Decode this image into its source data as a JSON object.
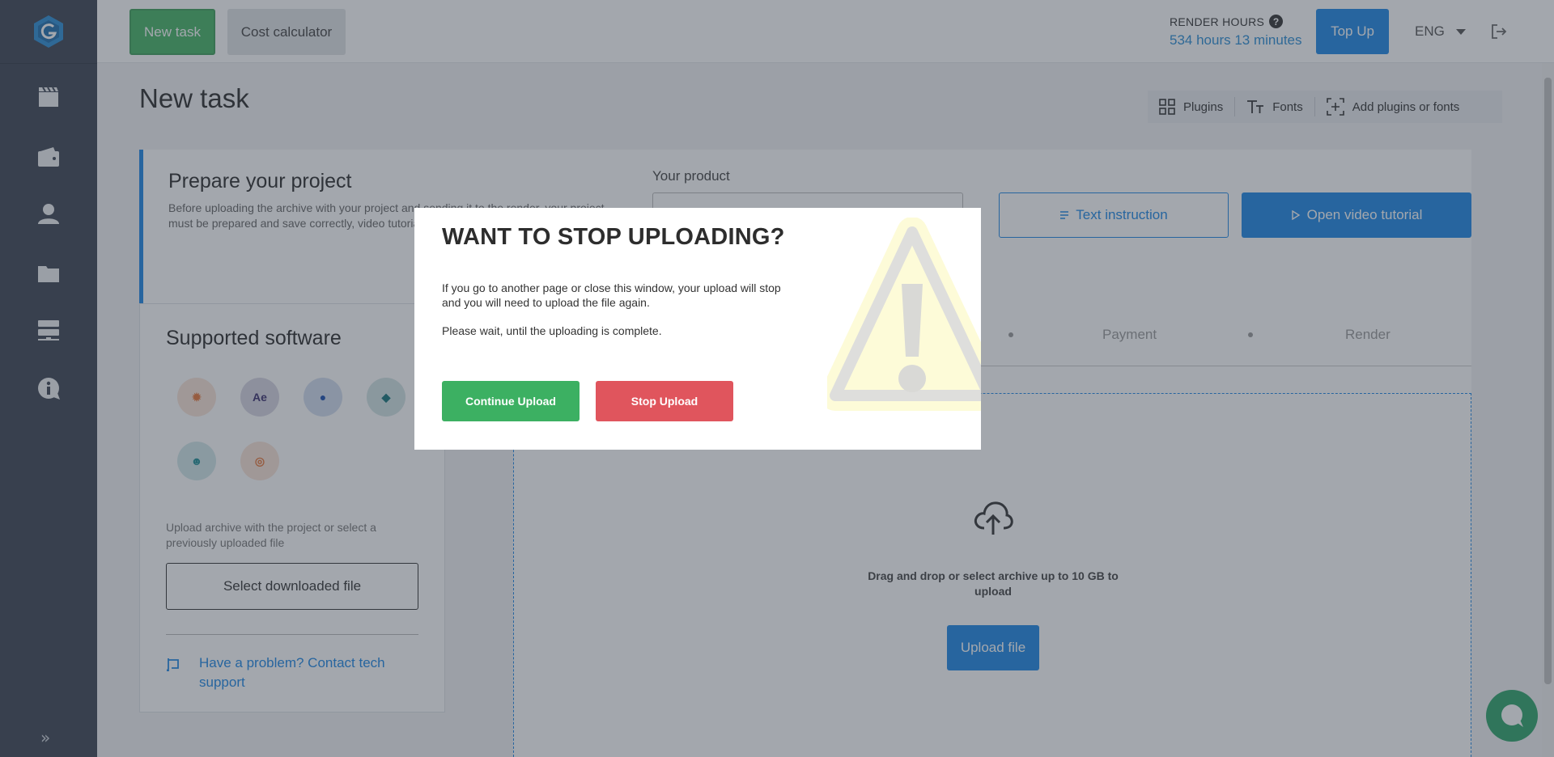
{
  "header": {
    "new_task_label": "New task",
    "cost_calculator_label": "Cost calculator",
    "render_hours_label": "RENDER HOURS",
    "render_hours_value": "534 hours 13 minutes",
    "top_up_label": "Top Up",
    "language": "ENG"
  },
  "page": {
    "title": "New task"
  },
  "toolbar": {
    "plugins_label": "Plugins",
    "fonts_label": "Fonts",
    "add_label": "Add plugins or fonts"
  },
  "prepare": {
    "title": "Prepare your project",
    "text": "Before uploading the archive with your project and sending it to the render, your project must be prepared and save correctly, video tutorial.",
    "product_label": "Your product",
    "text_instruction_label": "Text instruction",
    "video_tutorial_label": "Open video tutorial"
  },
  "supported": {
    "title": "Supported software",
    "software": [
      {
        "name": "blender-icon",
        "glyph": "✹",
        "color": "#e8773a"
      },
      {
        "name": "after-effects-icon",
        "glyph": "Ae",
        "color": "#3a2f6e"
      },
      {
        "name": "cinema4d-icon",
        "glyph": "●",
        "color": "#1b4fb0"
      },
      {
        "name": "unreal-icon",
        "glyph": "◆",
        "color": "#17757a"
      },
      {
        "name": "zbrush-icon",
        "glyph": "☻",
        "color": "#1f8e95"
      },
      {
        "name": "houdini-icon",
        "glyph": "◎",
        "color": "#e8773a"
      }
    ],
    "hint": "Upload archive with the project or select a previously uploaded file",
    "select_file_label": "Select downloaded file",
    "support_link": "Have a problem? Contact tech support"
  },
  "steps": {
    "payment_label": "Payment",
    "render_label": "Render"
  },
  "upload": {
    "drop_text": "Drag and drop or select archive up to 10 GB to upload",
    "upload_label": "Upload file"
  },
  "modal": {
    "title": "WANT TO STOP UPLOADING?",
    "text1": "If you go to another page or close this window, your upload will stop and you will need to upload the file again.",
    "text2": "Please wait, until the uploading is complete.",
    "continue_label": "Continue Upload",
    "stop_label": "Stop Upload"
  },
  "colors": {
    "accent": "#1e88e5",
    "success": "#3cb062",
    "danger": "#e0555d",
    "sidebar": "#3c4452"
  }
}
